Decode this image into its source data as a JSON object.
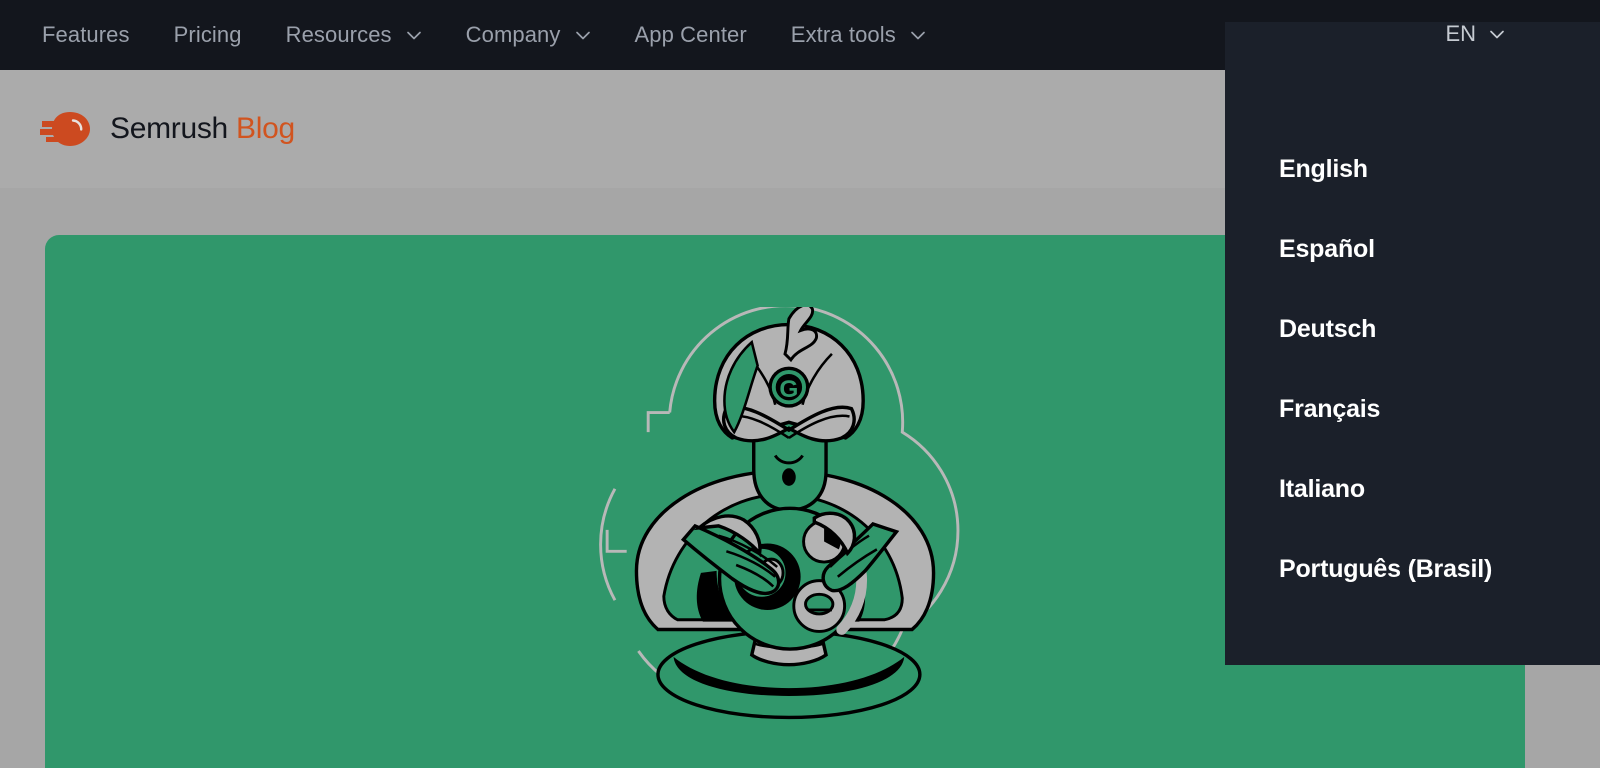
{
  "topnav": {
    "items": [
      {
        "label": "Features",
        "has_caret": false,
        "icon": ""
      },
      {
        "label": "Pricing",
        "has_caret": false,
        "icon": ""
      },
      {
        "label": "Resources",
        "has_caret": true,
        "icon": "chevron-down-icon"
      },
      {
        "label": "Company",
        "has_caret": true,
        "icon": "chevron-down-icon"
      },
      {
        "label": "App Center",
        "has_caret": false,
        "icon": ""
      },
      {
        "label": "Extra tools",
        "has_caret": true,
        "icon": "chevron-down-icon"
      }
    ],
    "language_selector": {
      "label": "EN",
      "icon": "chevron-down-icon",
      "expanded": true
    }
  },
  "header": {
    "logo_icon": "semrush-comet-logo-icon",
    "brand_name": "Semrush",
    "brand_section": "Blog"
  },
  "language_dropdown": {
    "options": [
      {
        "label": "English"
      },
      {
        "label": "Español"
      },
      {
        "label": "Deutsch"
      },
      {
        "label": "Français"
      },
      {
        "label": "Italiano"
      },
      {
        "label": "Português (Brasil)"
      }
    ]
  },
  "hero": {
    "illustration_name": "fortune-teller-crystal-ball-illustration",
    "badge_letter": "G"
  },
  "colors": {
    "nav_background": "#13161d",
    "nav_text": "#9aa0ab",
    "dropdown_background": "#1b202a",
    "dropdown_text": "#ffffff",
    "header_background": "#ababab",
    "page_background": "#a6a6a6",
    "hero_green": "#30976b",
    "brand_orange": "#d1541f",
    "brand_dark": "#13161d",
    "illustration_gray": "#b3b3b3",
    "illustration_outline": "#000000"
  }
}
